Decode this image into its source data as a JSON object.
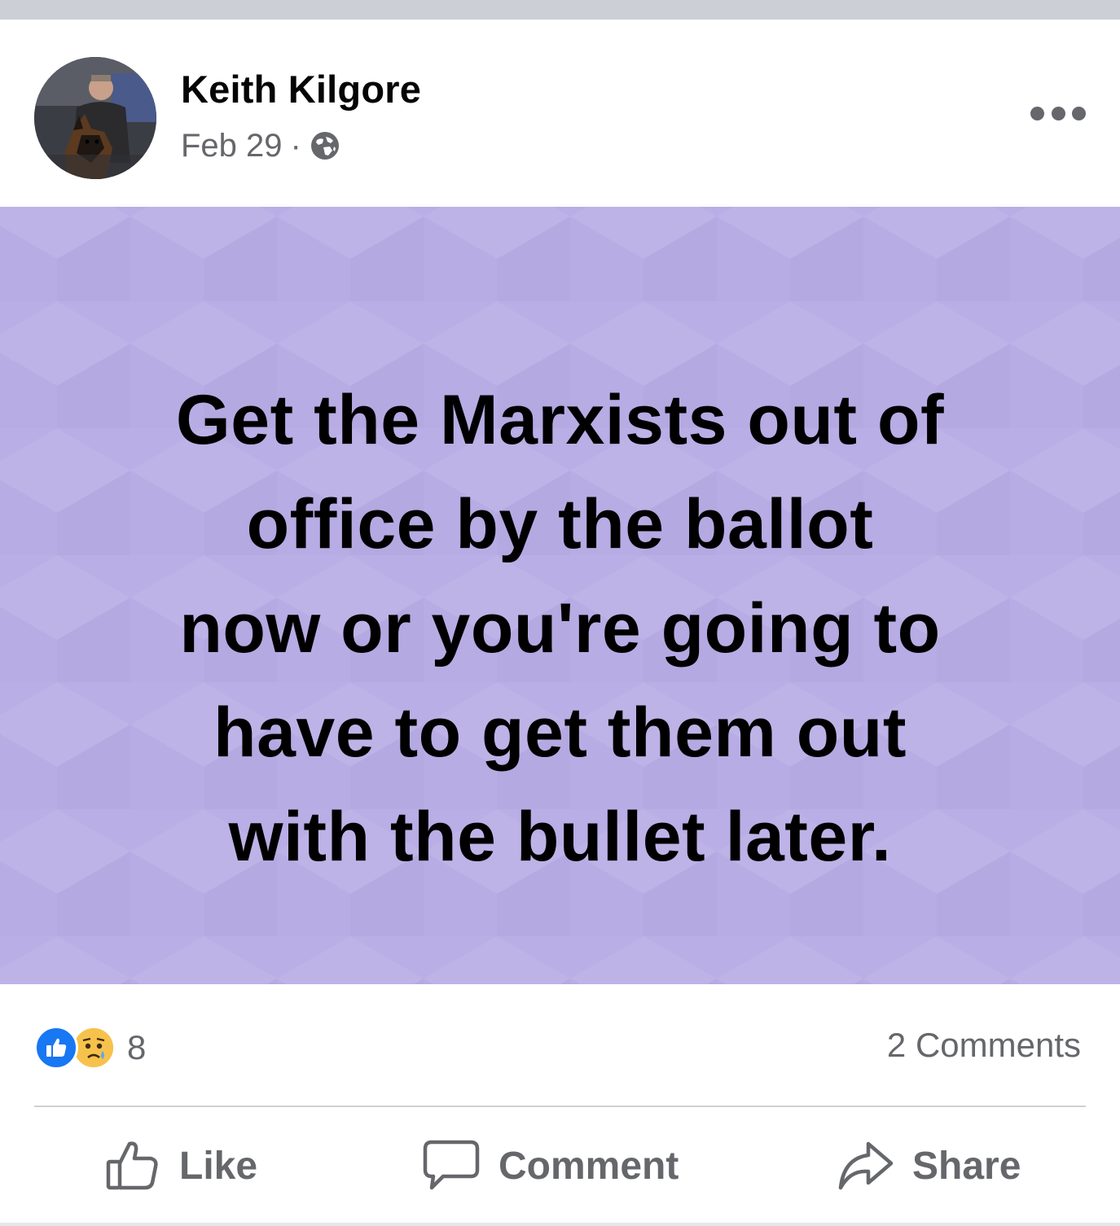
{
  "post": {
    "author": "Keith Kilgore",
    "date": "Feb 29",
    "separator": "·",
    "audience_icon": "globe-icon",
    "more_icon": "ellipsis-icon",
    "text_lines": [
      "Get the Marxists out of",
      "office by the ballot",
      "now or you're going to",
      "have to get them out",
      "with the bullet later."
    ],
    "background_color": "#b9aee5"
  },
  "reactions": {
    "icons": [
      "like-reaction-icon",
      "sad-reaction-icon"
    ],
    "count": "8",
    "comments": "2 Comments"
  },
  "actions": {
    "like": "Like",
    "comment": "Comment",
    "share": "Share"
  },
  "colors": {
    "brand_blue": "#1877f2",
    "secondary_text": "#65676b",
    "primary_text": "#050505"
  }
}
